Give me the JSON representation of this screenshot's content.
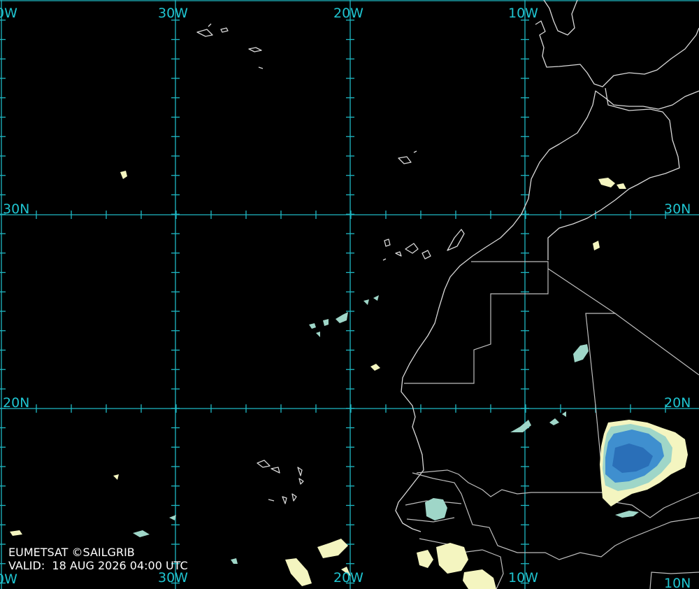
{
  "map": {
    "longitude_labels": [
      "0W",
      "30W",
      "20W",
      "10W"
    ],
    "longitude_labels_bottom": [
      "0W",
      "30W",
      "20W",
      "10W",
      "10N"
    ],
    "latitude_labels": [
      "30N",
      "20N"
    ],
    "colors": {
      "background": "#000000",
      "grid": "#1fb8c4",
      "coastline": "#d8d8d8",
      "cloud_low": "#f4f5c0",
      "cloud_mid": "#9fd6c8",
      "cloud_high": "#3f8fcf"
    }
  },
  "credits": {
    "source": "EUMETSAT ©SAILGRIB",
    "valid": "VALID:  18 AUG 2026 04:00 UTC"
  }
}
